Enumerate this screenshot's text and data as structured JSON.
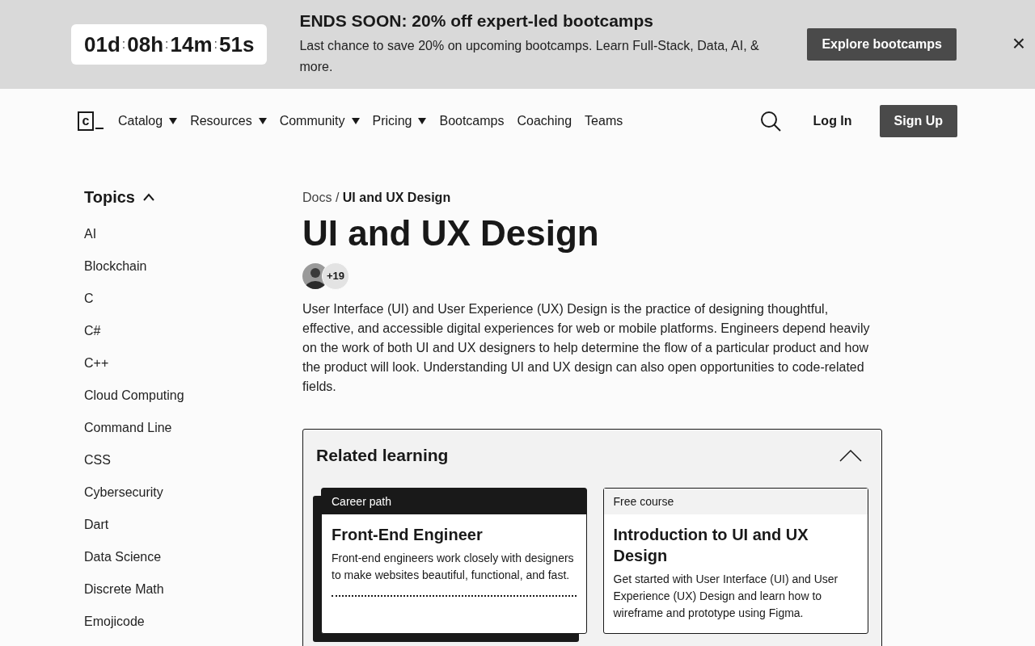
{
  "promo_banner": {
    "timer": {
      "segments": [
        "01d",
        "08h",
        "14m",
        "51s"
      ],
      "separators": [
        ":",
        ":",
        ":"
      ]
    },
    "title": "ENDS SOON: 20% off expert-led bootcamps",
    "text": "Last chance to save 20% on upcoming bootcamps. Learn Full-Stack, Data, AI, & more.",
    "button": "Explore bootcamps",
    "close": "×"
  },
  "nav": {
    "logo": "c",
    "items": [
      {
        "label": "Catalog",
        "dropdown": true
      },
      {
        "label": "Resources",
        "dropdown": true
      },
      {
        "label": "Community",
        "dropdown": true
      },
      {
        "label": "Pricing",
        "dropdown": true
      },
      {
        "label": "Bootcamps",
        "dropdown": false
      },
      {
        "label": "Coaching",
        "dropdown": false
      },
      {
        "label": "Teams",
        "dropdown": false
      }
    ],
    "login": "Log In",
    "signup": "Sign Up"
  },
  "sidebar": {
    "title": "Topics",
    "expanded": true,
    "items": [
      "AI",
      "Blockchain",
      "C",
      "C#",
      "C++",
      "Cloud Computing",
      "Command Line",
      "CSS",
      "Cybersecurity",
      "Dart",
      "Data Science",
      "Discrete Math",
      "Emojicode"
    ]
  },
  "breadcrumb": {
    "parent": "Docs",
    "separator": "/",
    "current": "UI and UX Design"
  },
  "title": "UI and UX Design",
  "contributors": {
    "count": "+19"
  },
  "description": "User Interface (UI) and User Experience (UX) Design is the practice of designing thoughtful, effective, and accessible digital experiences for web or mobile platforms. Engineers depend heavily on the work of both UI and UX designers to help determine the flow of a particular product and how the product will look. Understanding UI and UX design can also open opportunities to code-related fields.",
  "related": {
    "title": "Related learning",
    "expanded": true,
    "cards": [
      {
        "kind": "path",
        "tag": "Career path",
        "title": "Front-End Engineer",
        "text": "Front-end engineers work closely with designers to make websites beautiful, functional, and fast."
      },
      {
        "kind": "course",
        "tag": "Free course",
        "title": "Introduction to UI and UX Design",
        "text": "Get started with User Interface (UI) and User Experience (UX) Design and learn how to wireframe and prototype using Figma."
      }
    ]
  }
}
